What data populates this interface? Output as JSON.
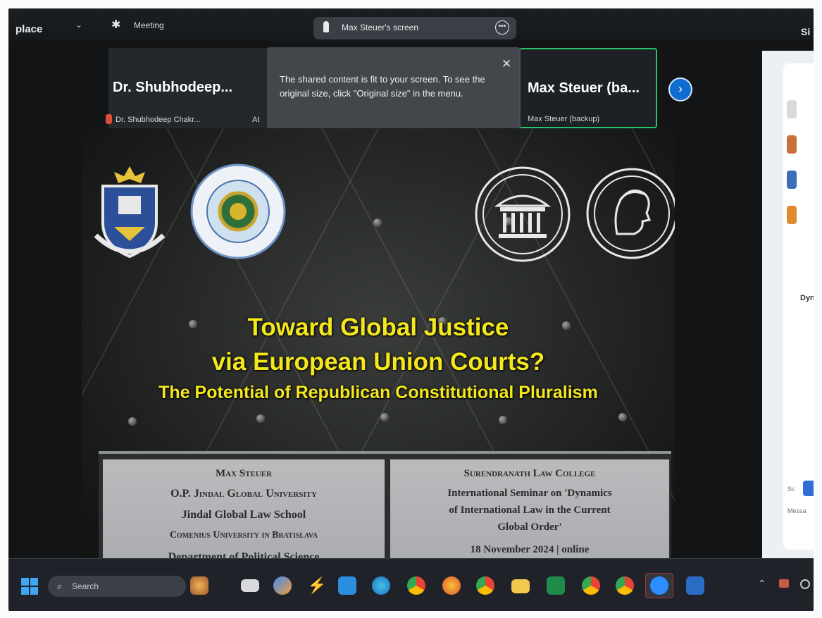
{
  "zoom_topbar": {
    "workplace_fragment": "place",
    "meeting_label": "Meeting",
    "right_fragment": "Si"
  },
  "screen_share_pill": {
    "label": "Max Steuer's screen"
  },
  "participants": [
    {
      "name": "Dr. Shubhodeep...",
      "label": "Dr. Shubhodeep Chakr...",
      "extra": "At"
    },
    {
      "name": "Max Steuer (ba...",
      "label": "Max Steuer (backup)"
    }
  ],
  "toast": {
    "message": "The shared content is fit to your screen. To see the original size, click \"Original size\" in the menu."
  },
  "side_panel": {
    "fragments": [
      "Dyn",
      "Sc",
      "Messa"
    ]
  },
  "slide": {
    "title_line1": "Toward Global Justice",
    "title_line2": "via European Union Courts?",
    "subtitle": "The Potential of Republican Constitutional Pluralism",
    "speaker": {
      "name": "Max Steuer",
      "affiliation1": "O.P. Jindal Global University",
      "school": "Jindal Global Law School",
      "affiliation2": "Comenius University in Bratislava",
      "department": "Department of Political Science"
    },
    "event": {
      "host": "Surendranath Law College",
      "seminar_line1": "International Seminar on 'Dynamics",
      "seminar_line2": "of International Law in the Current",
      "seminar_line3": "Global Order'",
      "date": "18 November 2024 | online"
    },
    "title_color": "#f4e81c"
  },
  "taskbar": {
    "search_placeholder": "Search",
    "apps": [
      "widgets-icon",
      "file-explorer-icon",
      "copilot-icon",
      "power-automate-icon",
      "store-icon",
      "edge-icon",
      "chrome-icon",
      "firefox-icon",
      "chrome-icon-2",
      "folder-icon",
      "excel-icon",
      "chrome-icon-3",
      "chrome-icon-4",
      "zoom-icon",
      "word-icon"
    ]
  },
  "colors": {
    "active_speaker_border": "#27c46b",
    "accent_blue": "#0f6cd1",
    "taskbar": "#1f2228"
  }
}
